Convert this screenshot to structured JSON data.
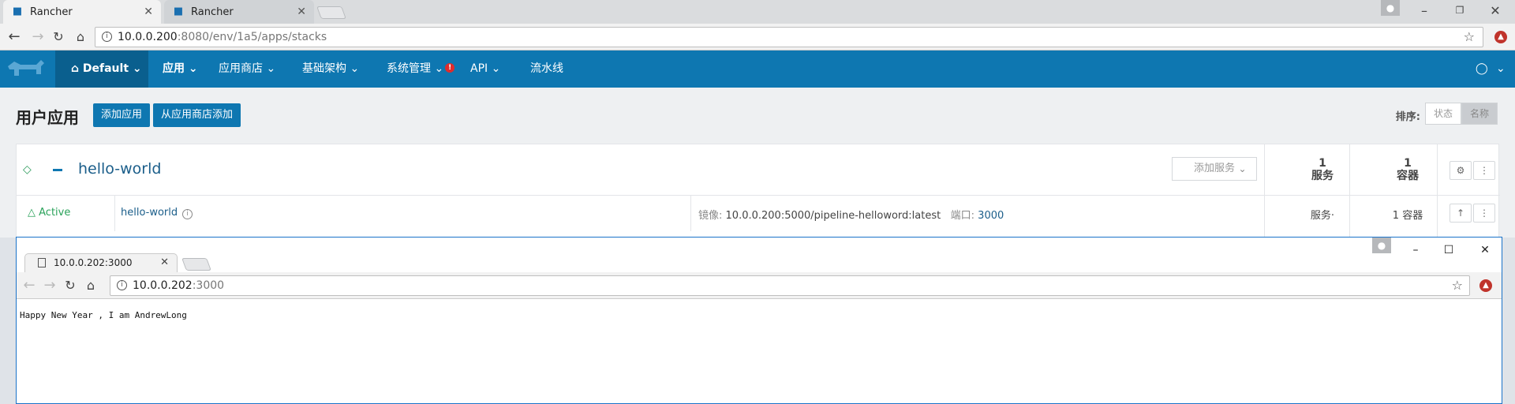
{
  "browser": {
    "tabs": [
      {
        "title": "Rancher",
        "active": true
      },
      {
        "title": "Rancher",
        "active": false
      }
    ],
    "url": {
      "host": "10.0.0.200",
      "path": ":8080/env/1a5/apps/stacks"
    }
  },
  "header": {
    "env_label": "Default",
    "menu": [
      {
        "label": "应用",
        "active": true
      },
      {
        "label": "应用商店"
      },
      {
        "label": "基础架构"
      },
      {
        "label": "系统管理",
        "alert": "!"
      },
      {
        "label": "API"
      },
      {
        "label": "流水线"
      }
    ]
  },
  "page": {
    "title": "用户应用",
    "add_app_button": "添加应用",
    "add_from_catalog_button": "从应用商店添加",
    "sort_label": "排序:",
    "sort_options": [
      "状态",
      "名称"
    ]
  },
  "stack": {
    "name": "hello-world",
    "add_service_button": "添加服务",
    "services_count": "1",
    "services_unit": "服务",
    "containers_count": "1",
    "containers_unit": "容器",
    "service": {
      "state": "Active",
      "name": "hello-world",
      "image_label": "镜像:",
      "image": "10.0.0.200:5000/pipeline-helloword:latest",
      "port_label": "端口:",
      "port": "3000",
      "scale_text": "服务·",
      "container_text": "1 容器"
    }
  },
  "front_window": {
    "tab_title": "10.0.0.202:3000",
    "url": {
      "host": "10.0.0.202",
      "path": ":3000"
    },
    "body_text": "Happy New Year , I am AndrewLong"
  },
  "colors": {
    "brand": "#0e77b1",
    "active_green": "#2aa25a",
    "alert": "#e02c2c"
  }
}
